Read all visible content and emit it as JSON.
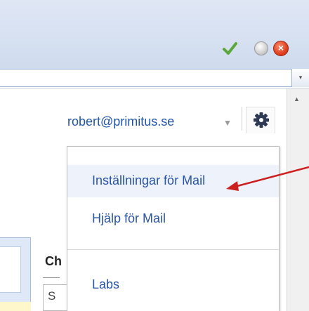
{
  "window": {
    "buttons": {
      "check_icon": "check-icon",
      "minimize_icon": "circle-icon",
      "close_icon": "close-x-icon",
      "close_glyph": "×"
    }
  },
  "addressbar": {
    "value": ""
  },
  "account": {
    "email": "robert@primitus.se",
    "caret": "▼"
  },
  "settings": {
    "icon": "gear-icon"
  },
  "menu": {
    "items": [
      {
        "label": "Inställningar för Mail",
        "highlighted": true
      },
      {
        "label": "Hjälp för Mail"
      },
      {
        "label": "Labs"
      }
    ]
  },
  "background": {
    "heading": "Ch",
    "field_text": "S"
  },
  "colors": {
    "link": "#2a54a8",
    "annotation_arrow": "#cc1f1f",
    "gear": "#2f3b55"
  }
}
